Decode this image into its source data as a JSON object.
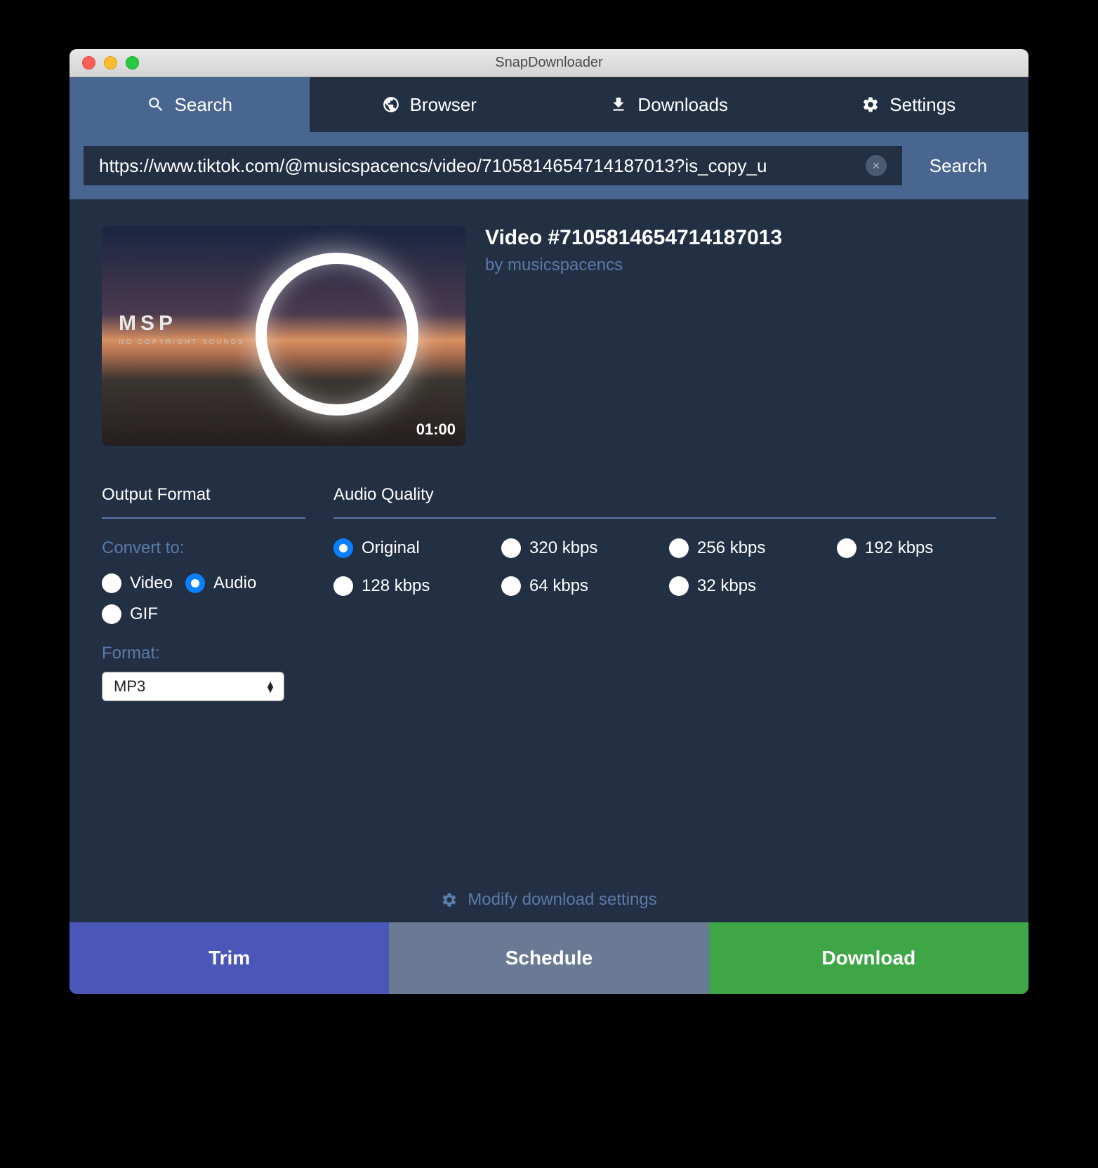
{
  "window_title": "SnapDownloader",
  "tabs": {
    "search": "Search",
    "browser": "Browser",
    "downloads": "Downloads",
    "settings": "Settings"
  },
  "search": {
    "value": "https://www.tiktok.com/@musicspacencs/video/7105814654714187013?is_copy_u",
    "button": "Search"
  },
  "video": {
    "title": "Video #7105814654714187013",
    "author": "by musicspacencs",
    "duration": "01:00",
    "thumb_logo": "MSP",
    "thumb_sub": "NO COPYRIGHT SOUNDS"
  },
  "output_format": {
    "heading": "Output Format",
    "convert_label": "Convert to:",
    "options": {
      "video": "Video",
      "audio": "Audio",
      "gif": "GIF"
    },
    "selected": "audio",
    "format_label": "Format:",
    "format_value": "MP3"
  },
  "audio_quality": {
    "heading": "Audio Quality",
    "options": [
      "Original",
      "320 kbps",
      "256 kbps",
      "192 kbps",
      "128 kbps",
      "64 kbps",
      "32 kbps"
    ],
    "selected": "Original"
  },
  "modify_label": "Modify download settings",
  "actions": {
    "trim": "Trim",
    "schedule": "Schedule",
    "download": "Download"
  }
}
